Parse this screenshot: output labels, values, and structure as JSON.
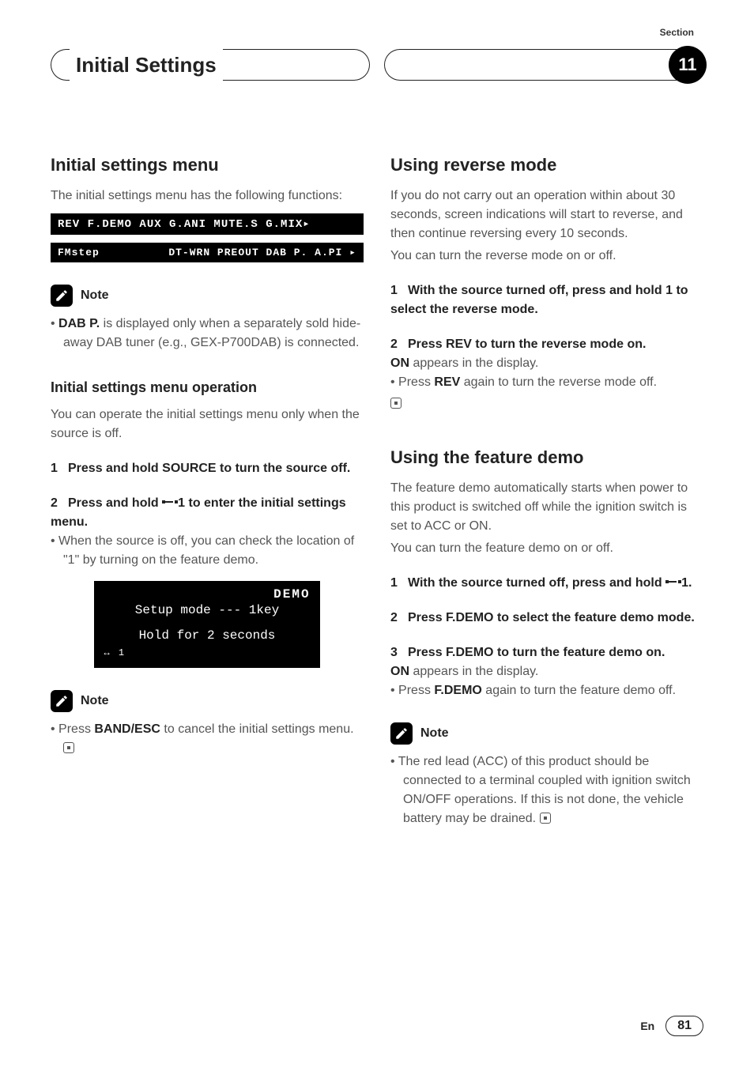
{
  "header": {
    "section_label": "Section",
    "title": "Initial Settings",
    "section_number": "11"
  },
  "left": {
    "h2": "Initial settings menu",
    "intro": "The initial settings menu has the following functions:",
    "lcd_row1": "REV  F.DEMO  AUX  G.ANI  MUTE.S  G.MIX▸",
    "lcd_row2_left": "FMstep",
    "lcd_row2_right": "DT-WRN  PREOUT  DAB P.  A.PI    ▸",
    "note1_label": "Note",
    "note1_bullet_lead": "DAB P.",
    "note1_bullet_rest": " is displayed only when a separately sold hide-away DAB tuner (e.g., GEX-P700DAB) is connected.",
    "h3": "Initial settings menu operation",
    "op_intro": "You can operate the initial settings menu only when the source is off.",
    "step1_pre": "Press and hold ",
    "step1_key": "SOURCE",
    "step1_post": " to turn the source off.",
    "step2_pre": "Press and hold ",
    "step2_post": "1 to enter the initial settings menu.",
    "step2_follow": "When the source is off, you can check the location of \"1\" by turning on the feature demo.",
    "demo_top": "DEMO",
    "demo_mid": "Setup mode --- 1key",
    "demo_hold": "Hold for 2 seconds",
    "demo_bl": "↔ 1",
    "note2_label": "Note",
    "note2_pre": "Press ",
    "note2_key": "BAND/ESC",
    "note2_post": " to cancel the initial settings menu."
  },
  "right": {
    "rev_h2": "Using reverse mode",
    "rev_intro1": "If you do not carry out an operation within about 30 seconds, screen indications will start to reverse, and then continue reversing every 10 seconds.",
    "rev_intro2": "You can turn the reverse mode on or off.",
    "rev_step1": "With the source turned off, press and hold 1 to select the reverse mode.",
    "rev_step2_pre": "Press ",
    "rev_step2_key": "REV",
    "rev_step2_post": " to turn the reverse mode on.",
    "rev_on_pre": "ON",
    "rev_on_post": " appears in the display.",
    "rev_bullet_pre": "Press ",
    "rev_bullet_key": "REV",
    "rev_bullet_post": " again to turn the reverse mode off.",
    "demo_h2": "Using the feature demo",
    "demo_intro1": "The feature demo automatically starts when power to this product is switched off while the ignition switch is set to ACC or ON.",
    "demo_intro2": "You can turn the feature demo on or off.",
    "demo_step1_pre": "With the source turned off, press and hold ",
    "demo_step1_post": "1.",
    "demo_step2_pre": "Press ",
    "demo_step2_key": "F.DEMO",
    "demo_step2_post": " to select the feature demo mode.",
    "demo_step3_pre": "Press ",
    "demo_step3_key": "F.DEMO",
    "demo_step3_post": " to turn the feature demo on.",
    "demo_on_pre": "ON",
    "demo_on_post": " appears in the display.",
    "demo_bullet_pre": "Press ",
    "demo_bullet_key": "F.DEMO",
    "demo_bullet_post": " again to turn the feature demo off.",
    "note3_label": "Note",
    "note3_text": "The red lead (ACC) of this product should be connected to a terminal coupled with ignition switch ON/OFF operations. If this is not done, the vehicle battery may be drained."
  },
  "footer": {
    "lang": "En",
    "page": "81"
  }
}
